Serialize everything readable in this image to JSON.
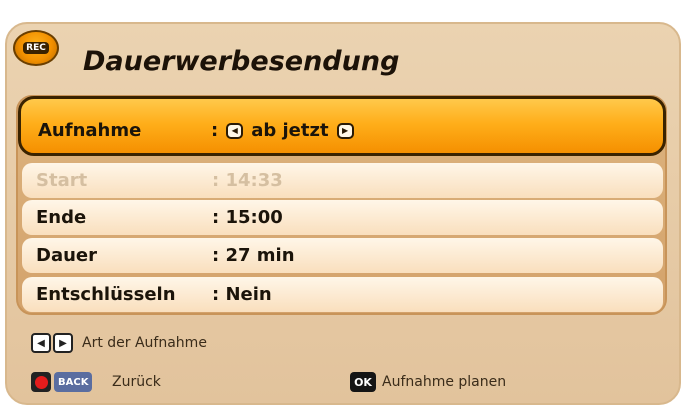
{
  "header": {
    "rec_badge": "REC",
    "title": "Dauerwerbesendung"
  },
  "rows": [
    {
      "label": "Aufnahme",
      "value": ": ",
      "selected_value": "ab jetzt"
    },
    {
      "label": "Start",
      "value": ": 14:33"
    },
    {
      "label": "Ende",
      "value": ": 15:00"
    },
    {
      "label": "Dauer",
      "value": ": 27 min"
    },
    {
      "label": "Entschlüsseln",
      "value": ": Nein"
    }
  ],
  "hints": {
    "arrows": "Art der Aufnahme",
    "back_key": "BACK",
    "back": "Zurück",
    "ok_key": "OK",
    "ok": "Aufnahme planen"
  },
  "colors": {
    "selected_row": "#ffae1a",
    "panel": "#e6c9a3",
    "record_dot": "#e41c1c"
  }
}
